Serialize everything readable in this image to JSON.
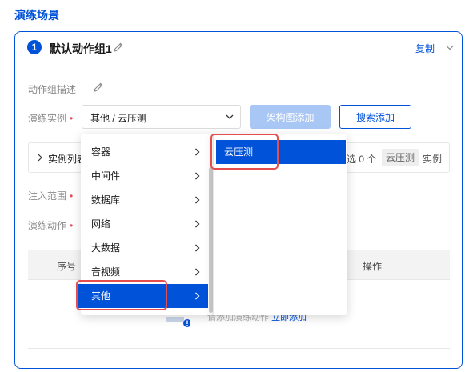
{
  "section": {
    "title": "演练场景"
  },
  "group": {
    "number": "1",
    "name": "默认动作组1",
    "copy_label": "复制"
  },
  "form": {
    "desc_label": "动作组描述",
    "instance_label": "演练实例",
    "scope_label": "注入范围",
    "action_label": "演练动作",
    "required_mark": "•",
    "selected_path": "其他 / 云压测",
    "btn_arch_add": "架构图添加",
    "btn_search_add": "搜索添加"
  },
  "instance_list": {
    "label": "实例列表",
    "selected_prefix": "选 0 个",
    "selected_tag": "云压测",
    "selected_suffix": "实例"
  },
  "table": {
    "headers": {
      "index": "序号",
      "ops": "操作"
    },
    "empty_text": "请添加演练动作",
    "empty_link": "立即添加"
  },
  "cascader": {
    "level1": [
      {
        "label": "容器",
        "active": false
      },
      {
        "label": "中间件",
        "active": false
      },
      {
        "label": "数据库",
        "active": false
      },
      {
        "label": "网络",
        "active": false
      },
      {
        "label": "大数据",
        "active": false
      },
      {
        "label": "音视频",
        "active": false
      },
      {
        "label": "其他",
        "active": true
      }
    ],
    "level2": [
      {
        "label": "云压测",
        "active": true
      }
    ]
  },
  "colors": {
    "brand": "#0052d9",
    "disabled_brand": "#a8c7f5",
    "required": "#e34d59",
    "highlight": "#e64d4d"
  },
  "icons": [
    "edit-icon",
    "chevron-down-icon",
    "chevron-right-icon",
    "empty-state-icon"
  ]
}
